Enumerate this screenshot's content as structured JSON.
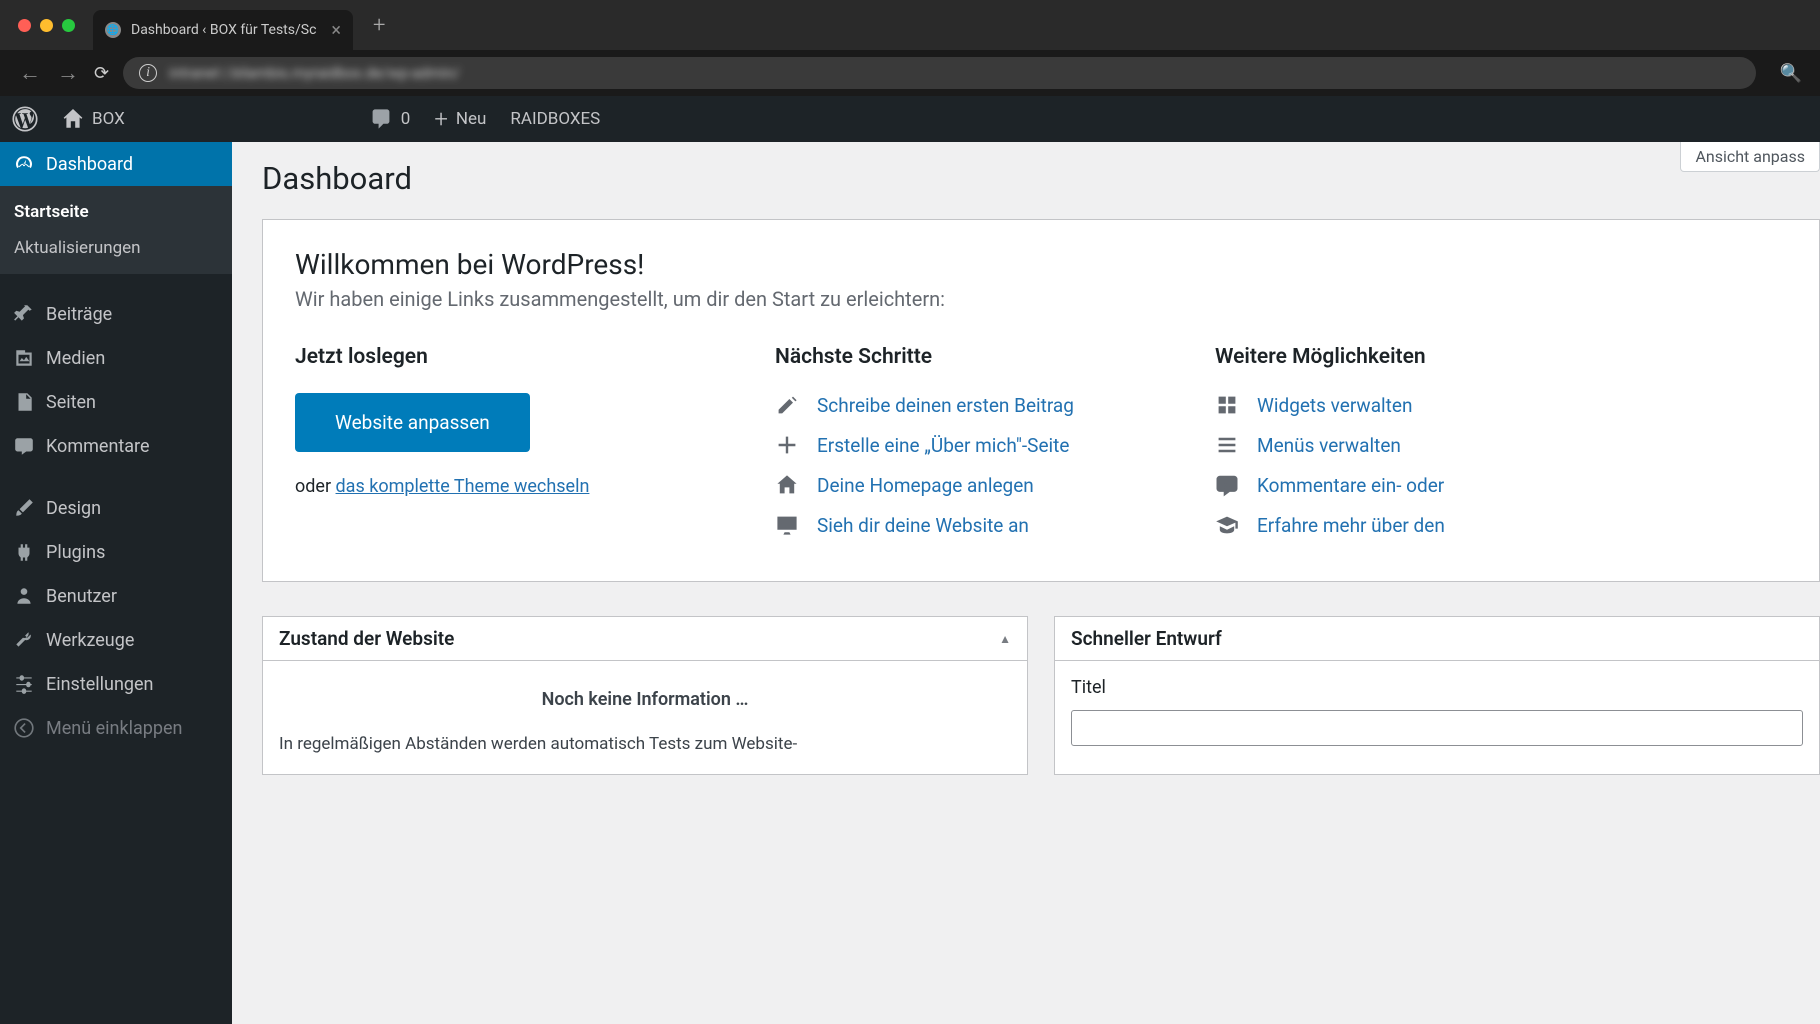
{
  "browser": {
    "tab_title": "Dashboard ‹ BOX für Tests/Sc",
    "url_blurred": "intranet | bilambis.myraidbox.de/wp-admin/"
  },
  "admin_bar": {
    "site_name": "BOX",
    "comments_count": "0",
    "new_label": "Neu",
    "custom_label": "RAIDBOXES"
  },
  "sidebar": {
    "dashboard": "Dashboard",
    "sub_home": "Startseite",
    "sub_updates": "Aktualisierungen",
    "posts": "Beiträge",
    "media": "Medien",
    "pages": "Seiten",
    "comments": "Kommentare",
    "appearance": "Design",
    "plugins": "Plugins",
    "users": "Benutzer",
    "tools": "Werkzeuge",
    "settings": "Einstellungen",
    "collapse": "Menü einklappen"
  },
  "main": {
    "screen_options": "Ansicht anpass",
    "page_title": "Dashboard",
    "welcome": {
      "heading": "Willkommen bei WordPress!",
      "subtitle": "Wir haben einige Links zusammengestellt, um dir den Start zu erleichtern:",
      "col1_heading": "Jetzt loslegen",
      "customize_button": "Website anpassen",
      "or_prefix": "oder ",
      "or_link": "das komplette Theme wechseln",
      "col2_heading": "Nächste Schritte",
      "next_steps": [
        "Schreibe deinen ersten Beitrag",
        "Erstelle eine „Über mich\"-Seite",
        "Deine Homepage anlegen",
        "Sieh dir deine Website an"
      ],
      "col3_heading": "Weitere Möglichkeiten",
      "more_actions": [
        "Widgets verwalten",
        "Menüs verwalten",
        "Kommentare ein- oder",
        "Erfahre mehr über den"
      ]
    },
    "site_health": {
      "title": "Zustand der Website",
      "no_info": "Noch keine Information …",
      "desc": "In regelmäßigen Abständen werden automatisch Tests zum Website-"
    },
    "quick_draft": {
      "title": "Schneller Entwurf",
      "title_label": "Titel"
    }
  }
}
